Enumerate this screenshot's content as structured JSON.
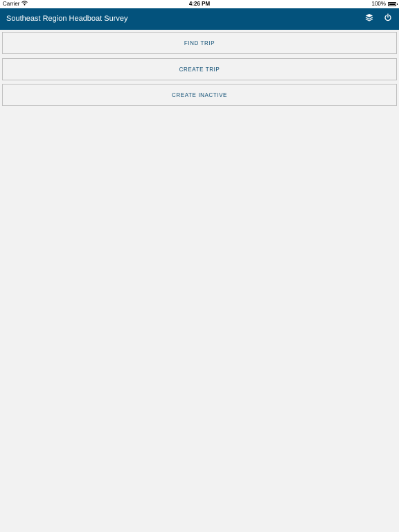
{
  "status_bar": {
    "carrier": "Carrier",
    "time": "4:26 PM",
    "battery": "100%"
  },
  "app_bar": {
    "title": "Southeast Region Headboat Survey",
    "background_color": "#03527c",
    "icons": [
      "layers-icon",
      "power-icon"
    ]
  },
  "actions": {
    "find_trip": "FIND TRIP",
    "create_trip": "CREATE TRIP",
    "create_inactive": "CREATE INACTIVE"
  },
  "colors": {
    "page_background": "#f2f2f2",
    "button_text": "#0d4d73",
    "button_border": "#bfbfbf"
  }
}
